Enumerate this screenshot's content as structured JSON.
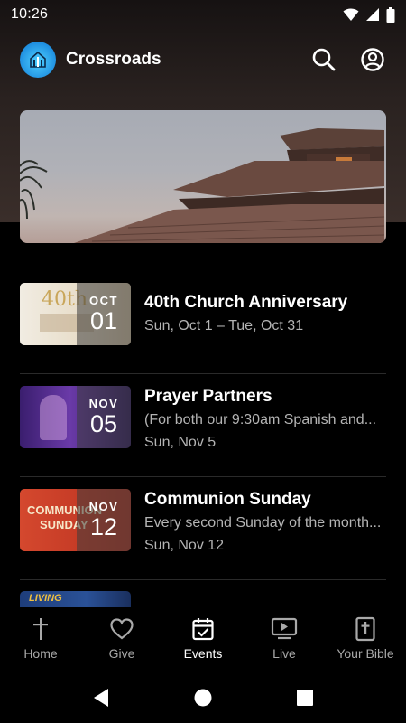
{
  "status_bar": {
    "time": "10:26"
  },
  "header": {
    "app_name": "Crossroads"
  },
  "events": [
    {
      "title": "40th Church Anniversary",
      "subtitle": "Sun, Oct 1 – Tue, Oct 31",
      "date_line": "",
      "badge_month": "OCT",
      "badge_day": "01"
    },
    {
      "title": "Prayer Partners",
      "subtitle": "(For both our 9:30am Spanish and...",
      "date_line": "Sun, Nov 5",
      "badge_month": "NOV",
      "badge_day": "05"
    },
    {
      "title": "Communion Sunday",
      "subtitle": "Every second Sunday of the month...",
      "date_line": "Sun, Nov 12",
      "badge_month": "NOV",
      "badge_day": "12"
    }
  ],
  "bottom_nav": [
    {
      "label": "Home",
      "icon": "cross-icon"
    },
    {
      "label": "Give",
      "icon": "heart-icon"
    },
    {
      "label": "Events",
      "icon": "calendar-check-icon",
      "active": true
    },
    {
      "label": "Live",
      "icon": "play-screen-icon"
    },
    {
      "label": "Your Bible",
      "icon": "bible-icon"
    }
  ],
  "thumb_text": {
    "anniversary": "40th",
    "communion_line1": "COMMUNION",
    "communion_line2": "SUNDAY",
    "partial": "LIVING"
  },
  "colors": {
    "background": "#000000",
    "accent": "#1f8fe0",
    "muted_text": "#b4b4b4"
  }
}
